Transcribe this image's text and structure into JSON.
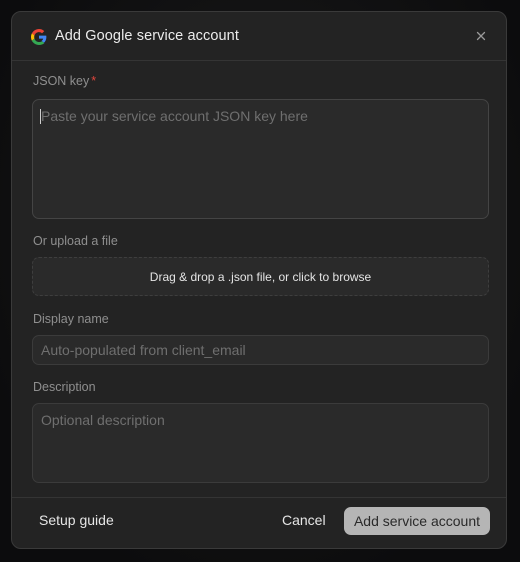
{
  "dialog": {
    "title": "Add Google service account",
    "close_icon": "close-icon",
    "brand_icon": "google-icon"
  },
  "json_key": {
    "label": "JSON key",
    "required_mark": "*",
    "placeholder": "Paste your service account JSON key here",
    "value": ""
  },
  "upload": {
    "label": "Or upload a file",
    "dropzone_text": "Drag & drop a .json file, or click to browse"
  },
  "display_name": {
    "label": "Display name",
    "placeholder": "Auto-populated from client_email",
    "value": ""
  },
  "description": {
    "label": "Description",
    "placeholder": "Optional description",
    "value": ""
  },
  "footer": {
    "setup_guide_label": "Setup guide",
    "cancel_label": "Cancel",
    "submit_label": "Add service account"
  },
  "colors": {
    "dialog_bg": "#232323",
    "field_bg": "#2a2a2a",
    "required": "#e0463d",
    "submit_bg": "#b5b5b5"
  }
}
